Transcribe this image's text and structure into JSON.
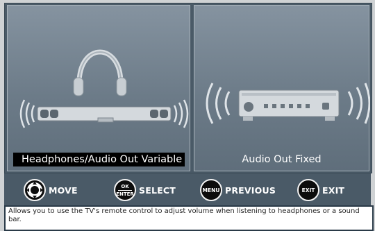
{
  "options": [
    {
      "label": "Headphones/Audio Out Variable",
      "selected": true,
      "icon": "headphones-soundbar-icon"
    },
    {
      "label": "Audio Out Fixed",
      "selected": false,
      "icon": "audio-receiver-icon"
    }
  ],
  "controls": {
    "move": {
      "label": "MOVE",
      "icon": "dpad-icon"
    },
    "select": {
      "label": "SELECT",
      "key_top": "OK",
      "key_bottom": "ENTER"
    },
    "previous": {
      "label": "PREVIOUS",
      "key": "MENU"
    },
    "exit": {
      "label": "EXIT",
      "key": "EXIT"
    }
  },
  "description": "Allows you to use the TV's remote control to adjust volume when listening to headphones or a sound bar.",
  "colors": {
    "panel_border": "#4a5a67",
    "selected_label_bg": "#000000",
    "text": "#ffffff"
  }
}
